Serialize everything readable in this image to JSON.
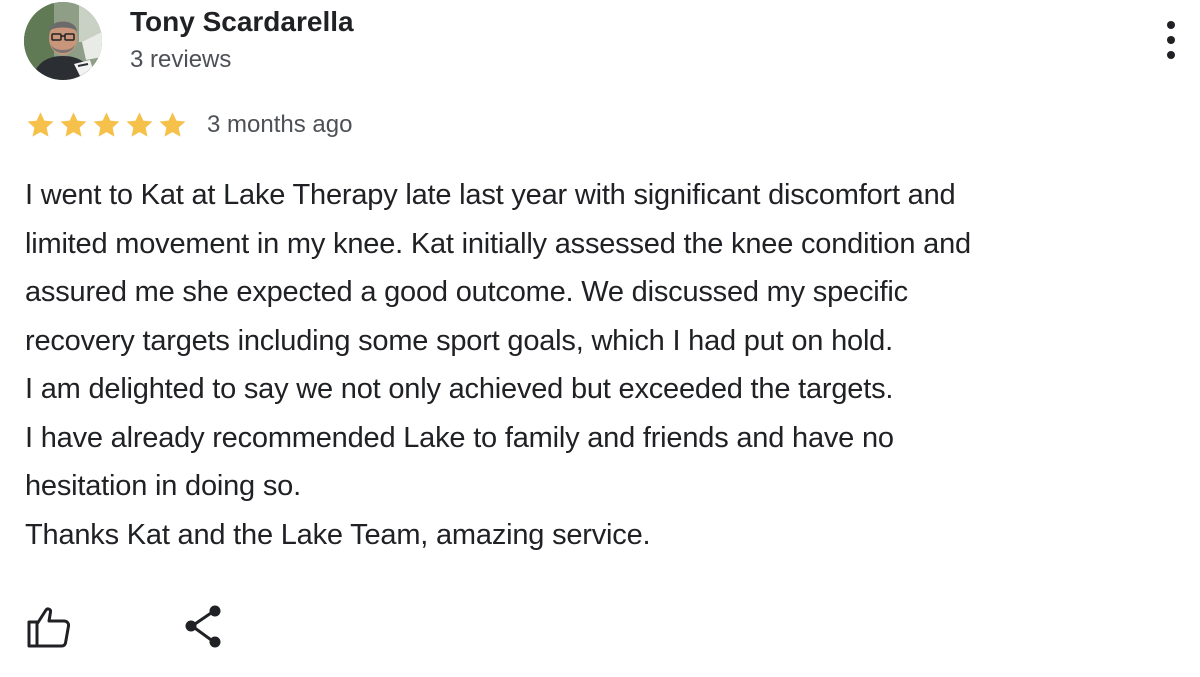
{
  "reviewer": {
    "name": "Tony Scardarella",
    "review_count": "3 reviews",
    "avatar_icon": "profile-photo"
  },
  "rating": {
    "stars": 5,
    "max_stars": 5,
    "star_color": "#f5c14a",
    "date": "3 months ago"
  },
  "review": {
    "lines": [
      "I went to Kat at Lake Therapy late last year with significant discomfort and",
      "limited movement in my knee. Kat initially assessed the knee condition and",
      "assured me she expected a good outcome. We discussed my specific",
      "recovery targets including some sport goals, which I had put on hold.",
      "I am delighted to say we not only achieved but exceeded the targets.",
      "I have already recommended Lake to family and friends and have no",
      "hesitation in doing so.",
      "Thanks Kat and the Lake Team, amazing service."
    ]
  },
  "actions": {
    "like_icon": "thumbs-up-icon",
    "share_icon": "share-icon",
    "more_icon": "more-vertical-icon"
  }
}
